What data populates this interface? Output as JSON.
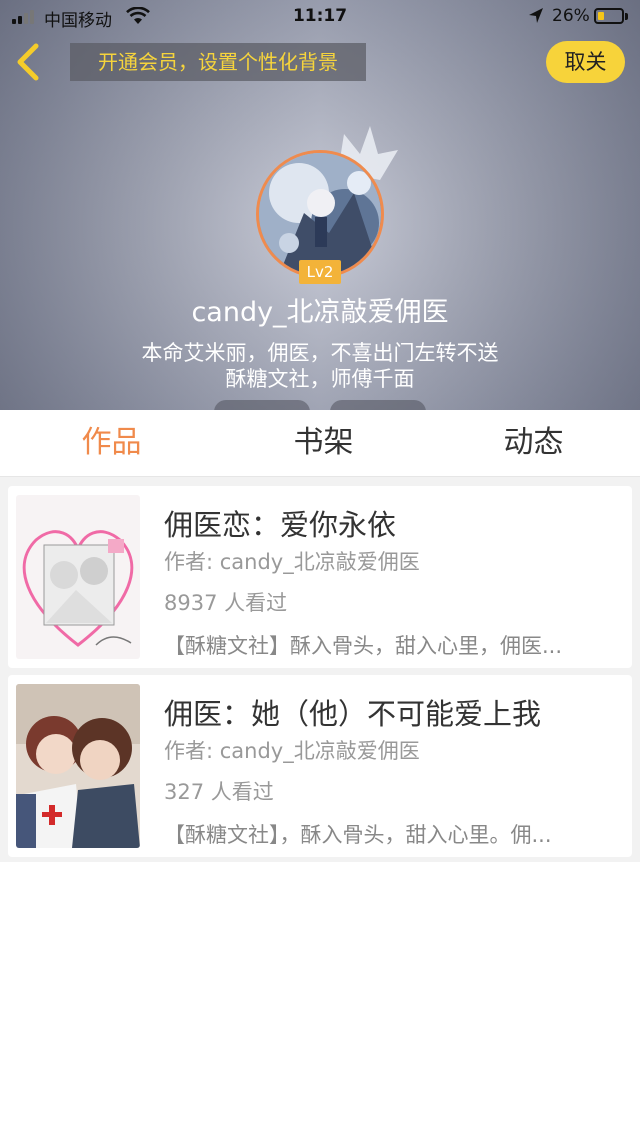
{
  "status_bar": {
    "carrier": "中国移动",
    "time": "11:17",
    "battery": "26%",
    "battery_level": 0.26
  },
  "header": {
    "vip_banner": "开通会员，设置个性化背景",
    "follow_label": "取关"
  },
  "profile": {
    "level": "Lv2",
    "username": "candy_北凉敲爱佣医",
    "bio": [
      "本命艾米丽，佣医，不喜出门左转不送",
      "酥糖文社，师傅千面"
    ]
  },
  "tabs": [
    {
      "label": "作品",
      "active": true
    },
    {
      "label": "书架",
      "active": false
    },
    {
      "label": "动态",
      "active": false
    }
  ],
  "works": [
    {
      "title": "佣医恋：爱你永依",
      "author": "作者: candy_北凉敲爱佣医",
      "views": "8937 人看过",
      "description": "【酥糖文社】酥入骨头，甜入心里，佣医..."
    },
    {
      "title": "佣医：她（他）不可能爱上我",
      "author": "作者: candy_北凉敲爱佣医",
      "views": "327 人看过",
      "description": "【酥糖文社】，酥入骨头，甜入心里。佣..."
    }
  ],
  "colors": {
    "accent": "#f08a4b",
    "follow_button": "#f7d33a",
    "vip_text": "#f6d43c",
    "level_badge": "#f3b339"
  }
}
